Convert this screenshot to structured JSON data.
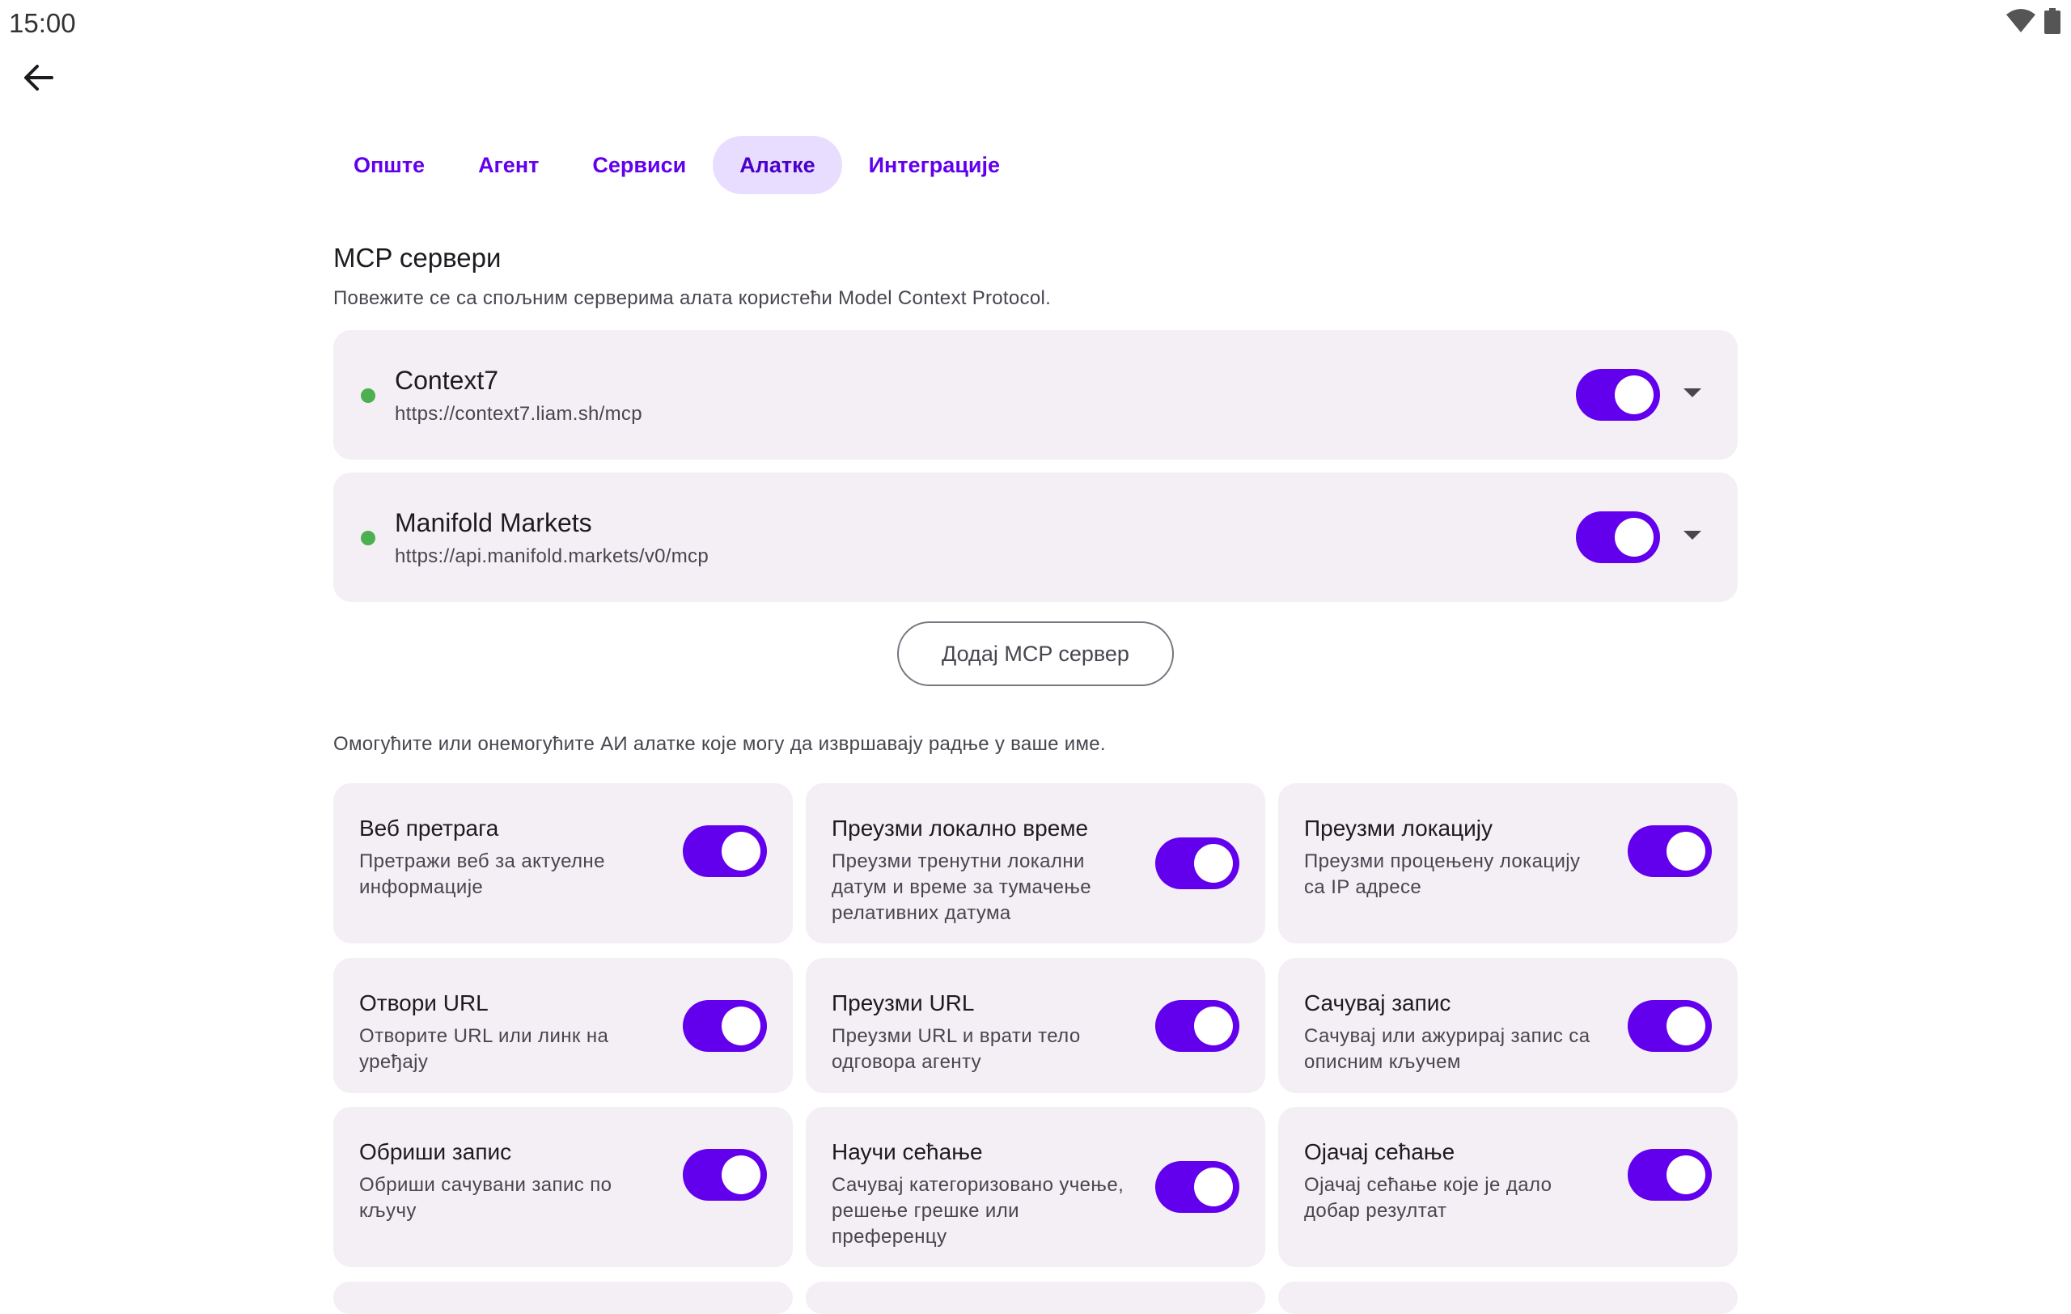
{
  "status_bar": {
    "time": "15:00",
    "icons": [
      "wifi-icon",
      "battery-icon"
    ]
  },
  "tabs": [
    {
      "label": "Опште",
      "active": false
    },
    {
      "label": "Агент",
      "active": false
    },
    {
      "label": "Сервиси",
      "active": false
    },
    {
      "label": "Алатке",
      "active": true
    },
    {
      "label": "Интеграције",
      "active": false
    }
  ],
  "mcp": {
    "title": "MCP сервери",
    "description": "Повежите се са спољним серверима алата користећи Model Context Protocol.",
    "servers": [
      {
        "name": "Context7",
        "url": "https://context7.liam.sh/mcp",
        "enabled": true,
        "status": "connected"
      },
      {
        "name": "Manifold Markets",
        "url": "https://api.manifold.markets/v0/mcp",
        "enabled": true,
        "status": "connected"
      }
    ],
    "add_button": "Додај MCP сервер"
  },
  "tools": {
    "description": "Омогућите или онемогућите АИ алатке које могу да извршавају радње у ваше име.",
    "items": [
      {
        "title": "Веб претрага",
        "description": "Претражи веб за актуелне информације",
        "enabled": true
      },
      {
        "title": "Преузми локално време",
        "description": "Преузми тренутни локални датум и време за тумачење релативних датума",
        "enabled": true
      },
      {
        "title": "Преузми локацију",
        "description": "Преузми процењену локацију са IP адресе",
        "enabled": true
      },
      {
        "title": "Отвори URL",
        "description": "Отворите URL или линк на уређају",
        "enabled": true
      },
      {
        "title": "Преузми URL",
        "description": "Преузми URL и врати тело одговора агенту",
        "enabled": true
      },
      {
        "title": "Сачувај запис",
        "description": "Сачувај или ажурирај запис са описним кључем",
        "enabled": true
      },
      {
        "title": "Обриши запис",
        "description": "Обриши сачувани запис по кључу",
        "enabled": true
      },
      {
        "title": "Научи сећање",
        "description": "Сачувај категоризовано учење, решење грешке или преференцу",
        "enabled": true
      },
      {
        "title": "Ојачај сећање",
        "description": "Ојачај сећање које је дало добар резултат",
        "enabled": true
      }
    ]
  },
  "colors": {
    "accent": "#6200ee",
    "active_tab_bg": "#e8ddff",
    "card_bg": "#f3eff5",
    "status_connected": "#4caf50"
  }
}
